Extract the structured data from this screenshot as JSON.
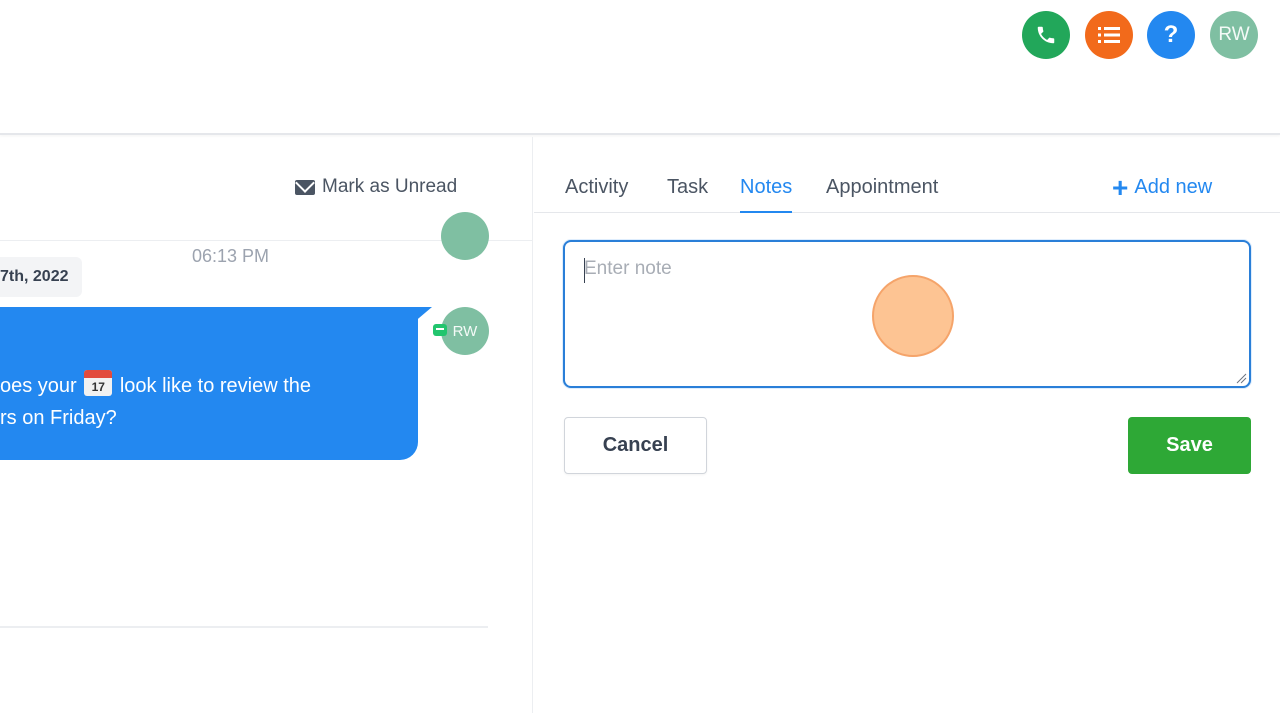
{
  "header": {
    "buttons": [
      {
        "icon": "phone-icon",
        "color": "#22a75a"
      },
      {
        "icon": "list-icon",
        "color": "#f26a1b"
      },
      {
        "icon": "help-icon",
        "label": "?",
        "color": "#2388f0"
      }
    ],
    "avatar_initials": "RW"
  },
  "conversation": {
    "mark_unread_label": "Mark as Unread",
    "timestamp": "06:13 PM",
    "date_chip": "7th, 2022",
    "message": {
      "line1_before": "oes your ",
      "emoji_day": "17",
      "line1_after": " look like to review the",
      "line2": "rs on Friday?",
      "avatar_initials": "RW"
    }
  },
  "panel": {
    "tabs": [
      {
        "label": "Activity"
      },
      {
        "label": "Task"
      },
      {
        "label": "Notes",
        "active": true
      },
      {
        "label": "Appointment"
      }
    ],
    "add_new_label": "Add new",
    "note_placeholder": "Enter note",
    "cancel_label": "Cancel",
    "save_label": "Save"
  },
  "colors": {
    "accent": "#2388f0",
    "save": "#2ea836"
  }
}
